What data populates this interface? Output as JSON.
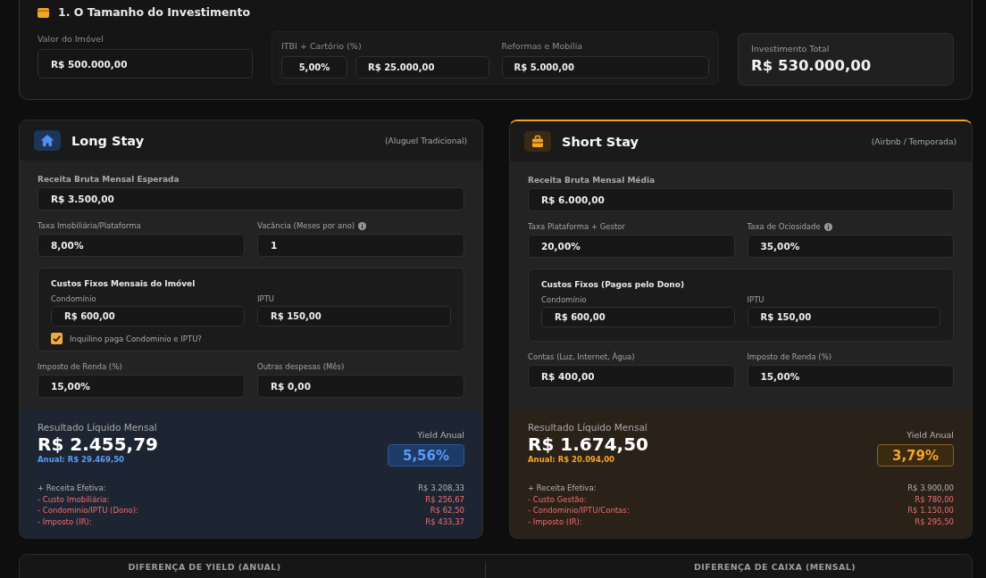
{
  "investment": {
    "title": "1. O Tamanho do Investimento",
    "property": {
      "label": "Valor do Imóvel",
      "value": "R$ 500.000,00"
    },
    "costs": [
      {
        "label": "ITBI + Cartório (%)",
        "values": [
          "5,00%",
          "R$ 25.000,00"
        ]
      },
      {
        "label": "Reformas e Mobília",
        "values": [
          "R$ 5.000,00"
        ]
      }
    ],
    "total": {
      "label": "Investimento Total",
      "value": "R$ 530.000,00"
    }
  },
  "scenarios": [
    {
      "kind": "long",
      "title": "Long Stay",
      "subtitle": "(Aluguel Tradicional)",
      "revenue": {
        "label": "Receita Bruta Mensal Esperada",
        "value": "R$ 3.500,00"
      },
      "rates": [
        {
          "label": "Taxa Imobiliária/Plataforma",
          "value": "8,00%"
        },
        {
          "label": "Vacância (Meses por ano)",
          "value": "1",
          "info": true
        }
      ],
      "fixed_costs": {
        "title": "Custos Fixos Mensais do Imóvel",
        "fields": [
          {
            "label": "Condomínio",
            "value": "R$ 600,00"
          },
          {
            "label": "IPTU",
            "value": "R$ 150,00"
          }
        ],
        "checkbox": {
          "label": "Inquilino paga Condominio e IPTU?",
          "checked": true
        }
      },
      "other": [
        {
          "label": "Imposto de Renda (%)",
          "value": "15,00%"
        },
        {
          "label": "Outras despesas (Mês)",
          "value": "R$ 0,00"
        }
      ],
      "result": {
        "label": "Resultado Líquido Mensal",
        "value": "R$ 2.455,79",
        "annual": "Anual: R$ 29.469,50",
        "yield_label": "Yield Anual",
        "yield": "5,56%",
        "breakdown": [
          {
            "kind": "income",
            "label": "+ Receita Efetiva:",
            "value": "R$ 3.208,33"
          },
          {
            "kind": "cost",
            "label": "- Custo Imobiliária:",
            "value": "R$ 256,67"
          },
          {
            "kind": "cost",
            "label": "- Condominio/IPTU (Dono):",
            "value": "R$ 62,50"
          },
          {
            "kind": "cost",
            "label": "- Imposto (IR):",
            "value": "R$ 433,37"
          }
        ]
      }
    },
    {
      "kind": "short",
      "title": "Short Stay",
      "subtitle": "(Airbnb / Temporada)",
      "revenue": {
        "label": "Receita Bruta Mensal Média",
        "value": "R$ 6.000,00"
      },
      "rates": [
        {
          "label": "Taxa Plataforma + Gestor",
          "value": "20,00%"
        },
        {
          "label": "Taxa de Ociosidade",
          "value": "35,00%",
          "info": true
        }
      ],
      "fixed_costs": {
        "title": "Custos Fixos (Pagos pelo Dono)",
        "fields": [
          {
            "label": "Condomínio",
            "value": "R$ 600,00"
          },
          {
            "label": "IPTU",
            "value": "R$ 150,00"
          }
        ]
      },
      "other": [
        {
          "label": "Contas (Luz, Internet, Água)",
          "value": "R$ 400,00"
        },
        {
          "label": "Imposto de Renda (%)",
          "value": "15,00%"
        }
      ],
      "result": {
        "label": "Resultado Líquido Mensal",
        "value": "R$ 1.674,50",
        "annual": "Anual: R$ 20.094,00",
        "yield_label": "Yield Anual",
        "yield": "3,79%",
        "breakdown": [
          {
            "kind": "income",
            "label": "+ Receita Efetiva:",
            "value": "R$ 3.900,00"
          },
          {
            "kind": "cost",
            "label": "- Custo Gestão:",
            "value": "R$ 780,00"
          },
          {
            "kind": "cost",
            "label": "- Condominio/IPTU/Contas:",
            "value": "R$ 1.150,00"
          },
          {
            "kind": "cost",
            "label": "- Imposto (IR):",
            "value": "R$ 295,50"
          }
        ]
      }
    }
  ],
  "comparison": {
    "headings": [
      "DIFERENÇA DE YIELD (ANUAL)",
      "DIFERENÇA DE CAIXA (MENSAL)"
    ]
  }
}
